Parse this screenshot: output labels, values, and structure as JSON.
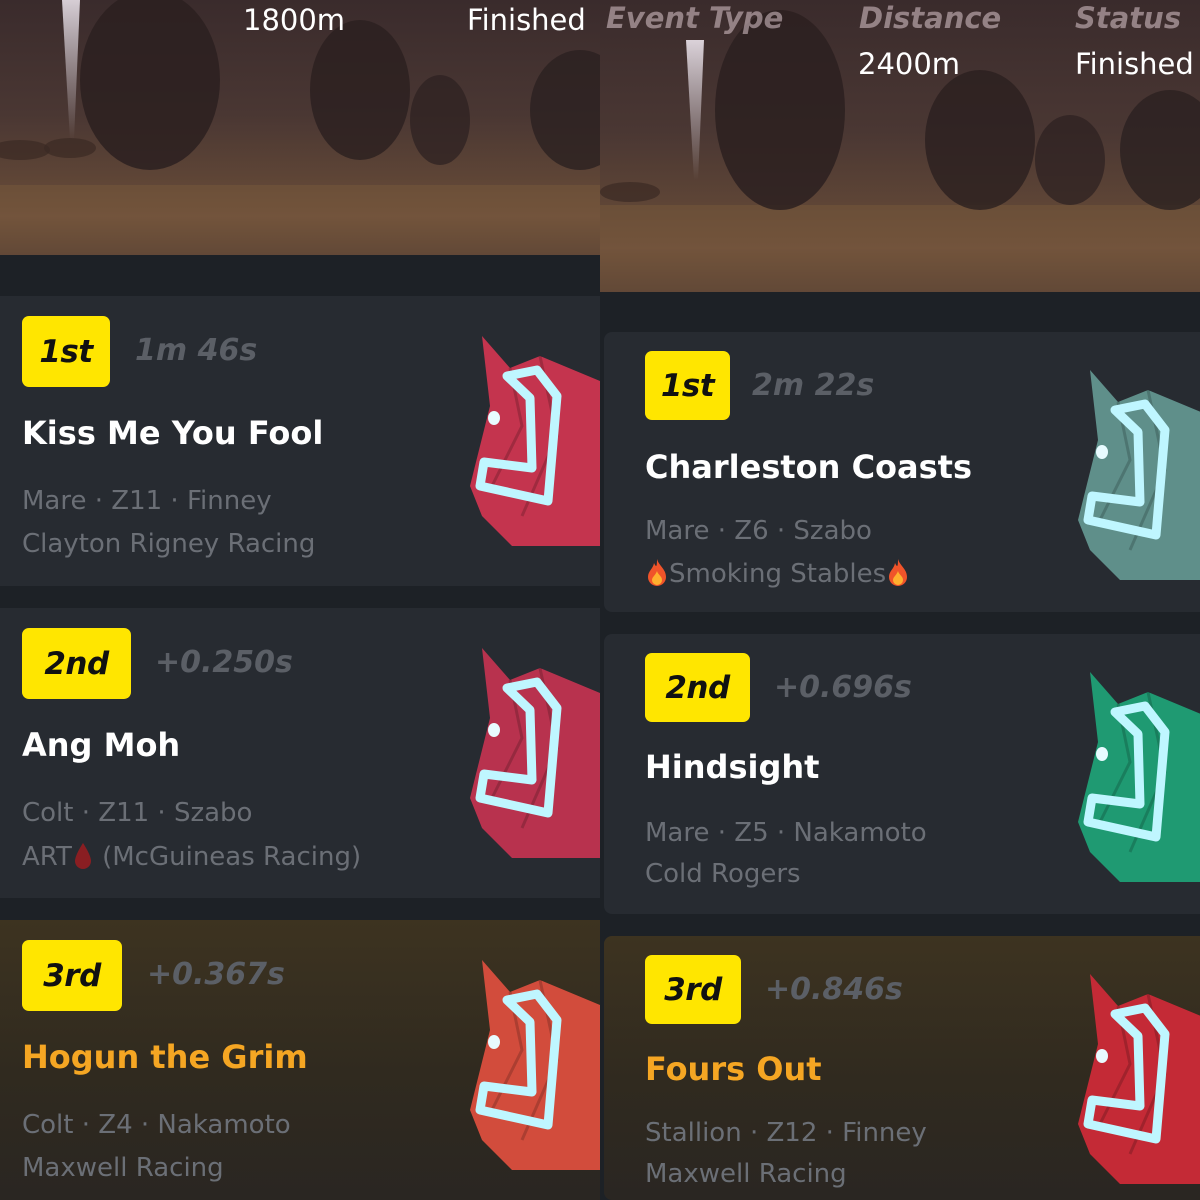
{
  "left": {
    "distance": "1800m",
    "status": "Finished",
    "results": [
      {
        "place": "1st",
        "time": "1m 46s",
        "name": "Kiss Me You Fool",
        "details": "Mare · Z11 · Finney",
        "stable": "Clayton Rigney Racing",
        "color": "#c4344e"
      },
      {
        "place": "2nd",
        "time": "+0.250s",
        "name": "Ang Moh",
        "details": "Colt · Z11 · Szabo",
        "stable_prefix": "ART",
        "stable_suffix": " (McGuineas Racing)",
        "color": "#b8324e"
      },
      {
        "place": "3rd",
        "time": "+0.367s",
        "name": "Hogun the Grim",
        "details": "Colt · Z4 · Nakamoto",
        "stable": "Maxwell Racing",
        "color": "#d24c3c"
      }
    ]
  },
  "right": {
    "headers": {
      "event_type": "Event Type",
      "distance": "Distance",
      "status": "Status"
    },
    "distance": "2400m",
    "status": "Finished",
    "results": [
      {
        "place": "1st",
        "time": "2m 22s",
        "name": "Charleston Coasts",
        "details": "Mare · Z6 · Szabo",
        "stable": "Smoking Stables",
        "color": "#5f8f8a"
      },
      {
        "place": "2nd",
        "time": "+0.696s",
        "name": "Hindsight",
        "details": "Mare · Z5 · Nakamoto",
        "stable": "Cold Rogers",
        "color": "#1f9a72"
      },
      {
        "place": "3rd",
        "time": "+0.846s",
        "name": "Fours Out",
        "details": "Stallion · Z12 · Finney",
        "stable": "Maxwell Racing",
        "color": "#c42a36"
      }
    ]
  },
  "icons": {
    "flame": "flame-icon",
    "blood_drop": "blood-drop-icon"
  },
  "colors": {
    "badge": "#ffe600",
    "gold_name": "#f5a623",
    "card": "#272b31",
    "halter": "#bff6ff"
  }
}
